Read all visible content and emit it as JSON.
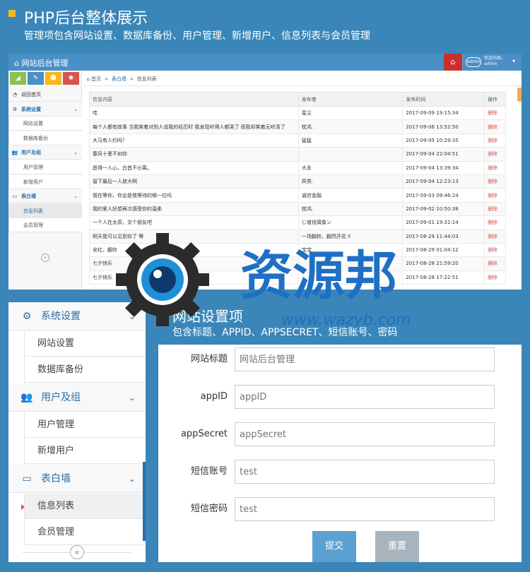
{
  "header": {
    "title": "PHP后台整体展示",
    "subtitle": "管理项包含网站设置、数据库备份、用户管理、新增用户、信息列表与会员管理"
  },
  "admin": {
    "brand": "网站后台管理",
    "user": {
      "greeting": "欢迎光临，",
      "name": "admin",
      "avatar": "admin"
    },
    "quick_colors": [
      "#8cc152",
      "#4a8fc6",
      "#f5b81c",
      "#d9534f"
    ],
    "sidebar": [
      {
        "type": "item",
        "label": "返回首页",
        "icon": "dashboard-icon"
      },
      {
        "type": "header",
        "label": "系统设置",
        "icon": "gear-icon"
      },
      {
        "type": "child",
        "label": "网站设置"
      },
      {
        "type": "child",
        "label": "数据库备份"
      },
      {
        "type": "header",
        "label": "用户及组",
        "icon": "users-icon"
      },
      {
        "type": "child",
        "label": "用户管理"
      },
      {
        "type": "child",
        "label": "新增用户"
      },
      {
        "type": "header",
        "label": "表白墙",
        "icon": "monitor-icon"
      },
      {
        "type": "child",
        "label": "信息列表",
        "active": true
      },
      {
        "type": "child",
        "label": "会员管理"
      }
    ],
    "breadcrumb": [
      "首页",
      "表白墙",
      "信息列表"
    ],
    "table": {
      "columns": [
        "信息内容",
        "发布者",
        "发布时间",
        "操作"
      ],
      "delete_label": "删除",
      "rows": [
        [
          "哇",
          "星尘",
          "2017-09-09 19:15:34"
        ],
        [
          "每个人都有故事 当我笑着对别人说我的经历时 我发现听得人都哭了 而我却笑着无听清了",
          "枕鸿.",
          "2017-09-06 13:52:50"
        ],
        [
          "大马有人约吗？",
          "猛猛",
          "2017-09-05 10:29:35"
        ],
        [
          "春风十里不如你",
          "",
          "2017-09-04 22:04:51"
        ],
        [
          "愿得一人心，白首不分离。",
          "大永",
          "2017-09-04 13:39:34"
        ],
        [
          "留下最后一人放大啊",
          "异类.",
          "2017-09-04 12:23:13"
        ],
        [
          "我在等你，你会是我等待的哪一位吗",
          "诚信金融",
          "2017-09-03 09:46:24"
        ],
        [
          "我的爱人好想再次感受你的温柔",
          "枕鸿.",
          "2017-09-02 10:50:38"
        ],
        [
          "一个人在太原，交个朋友吧",
          "じ值钱偶像ン",
          "2017-09-01 19:31:14"
        ],
        [
          "明天我可以见到你了 等",
          "一场翻转，翻然开花 ll",
          "2017-08-29 11:44:03"
        ],
        [
          "安红，翻你",
          "宝宝",
          "2017-08-29 01:04:12"
        ],
        [
          "七夕快乐",
          "",
          "2017-08-28 21:59:20"
        ],
        [
          "七夕快乐",
          "",
          "2017-08-28 17:22:51"
        ]
      ]
    }
  },
  "sidebar_detail": [
    {
      "type": "header",
      "label": "系统设置",
      "icon": "gear-icon"
    },
    {
      "type": "child",
      "label": "网站设置"
    },
    {
      "type": "child",
      "label": "数据库备份"
    },
    {
      "type": "header",
      "label": "用户及组",
      "icon": "users-icon"
    },
    {
      "type": "child",
      "label": "用户管理"
    },
    {
      "type": "child",
      "label": "新增用户"
    },
    {
      "type": "header",
      "label": "表白墙",
      "icon": "monitor-icon"
    },
    {
      "type": "child",
      "label": "信息列表",
      "active": true
    },
    {
      "type": "child",
      "label": "会员管理"
    }
  ],
  "settings": {
    "title": "网站设置项",
    "subtitle": "包含标题、APPID、APPSECRET、短信账号、密码",
    "fields": [
      {
        "label": "网站标题",
        "value": "",
        "placeholder": "网站后台管理"
      },
      {
        "label": "appID",
        "value": "",
        "placeholder": "appID"
      },
      {
        "label": "appSecret",
        "value": "",
        "placeholder": "appSecret"
      },
      {
        "label": "短信账号",
        "value": "test",
        "placeholder": ""
      },
      {
        "label": "短信密码",
        "value": "test",
        "placeholder": ""
      }
    ],
    "submit_label": "提交",
    "reset_label": "重置",
    "submit_color": "#5aa0d0",
    "reset_color": "#a8b4bd"
  },
  "watermark": {
    "text": "资源邦",
    "url": "www.wazyb.com"
  }
}
